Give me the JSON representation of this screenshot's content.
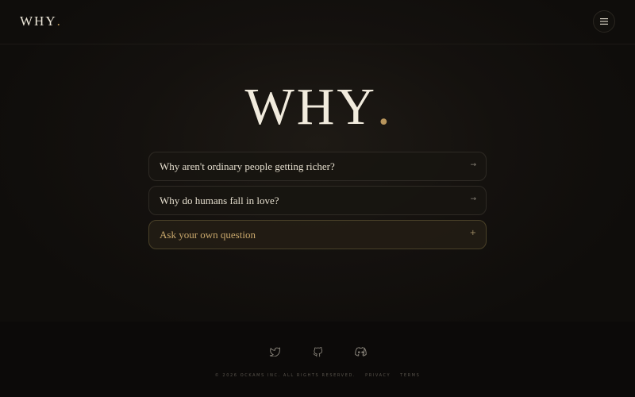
{
  "header": {
    "logo_text": "WHY",
    "logo_dot": ".",
    "menu_icon": "menu-icon"
  },
  "hero": {
    "title_text": "WHY",
    "title_dot": "."
  },
  "questions": [
    {
      "label": "Why aren't ordinary people getting richer?",
      "icon": "→"
    },
    {
      "label": "Why do humans fall in love?",
      "icon": "→"
    }
  ],
  "ask_own": {
    "label": "Ask your own question",
    "icon": "+"
  },
  "footer": {
    "socials": [
      "twitter-icon",
      "github-icon",
      "discord-icon"
    ],
    "copyright": "© 2026 OCKAMS INC. ALL RIGHTS RESERVED.",
    "privacy": "PRIVACY",
    "terms": "TERMS"
  },
  "colors": {
    "accent": "#b8955c",
    "background": "#0e0c0a",
    "text": "#e9e2d2"
  }
}
